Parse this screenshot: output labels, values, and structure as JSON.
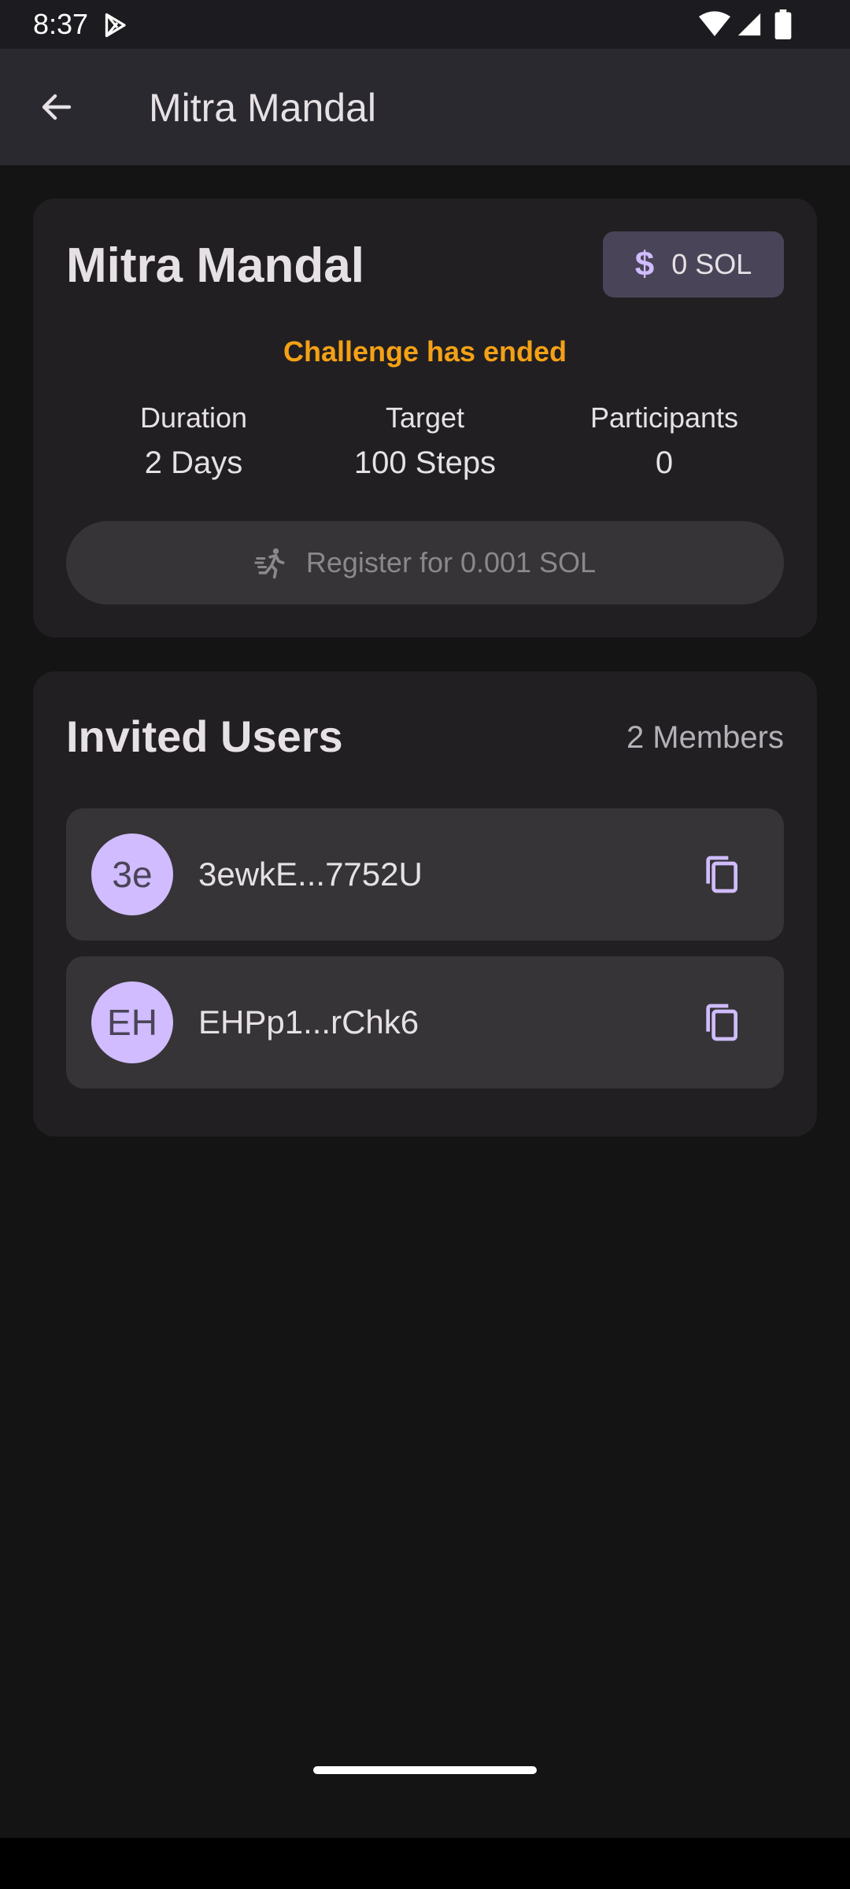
{
  "status_bar": {
    "time": "8:37"
  },
  "app_bar": {
    "title": "Mitra Mandal"
  },
  "challenge": {
    "name": "Mitra Mandal",
    "balance": "0 SOL",
    "status_text": "Challenge has ended",
    "stats": [
      {
        "label": "Duration",
        "value": "2 Days"
      },
      {
        "label": "Target",
        "value": "100 Steps"
      },
      {
        "label": "Participants",
        "value": "0"
      }
    ],
    "register_label": "Register for 0.001 SOL"
  },
  "invited_users": {
    "title": "Invited Users",
    "count_label": "2 Members",
    "users": [
      {
        "initials": "3e",
        "address": "3ewkE...7752U"
      },
      {
        "initials": "EH",
        "address": "EHPp1...rChk6"
      }
    ]
  },
  "colors": {
    "accent": "#d0bcff",
    "warning": "#f4a116",
    "background": "#141414",
    "card": "#211f21"
  },
  "icons": {
    "back": "arrow-left-icon",
    "balance": "dollar-icon",
    "register": "running-person-icon",
    "copy": "copy-icon"
  }
}
